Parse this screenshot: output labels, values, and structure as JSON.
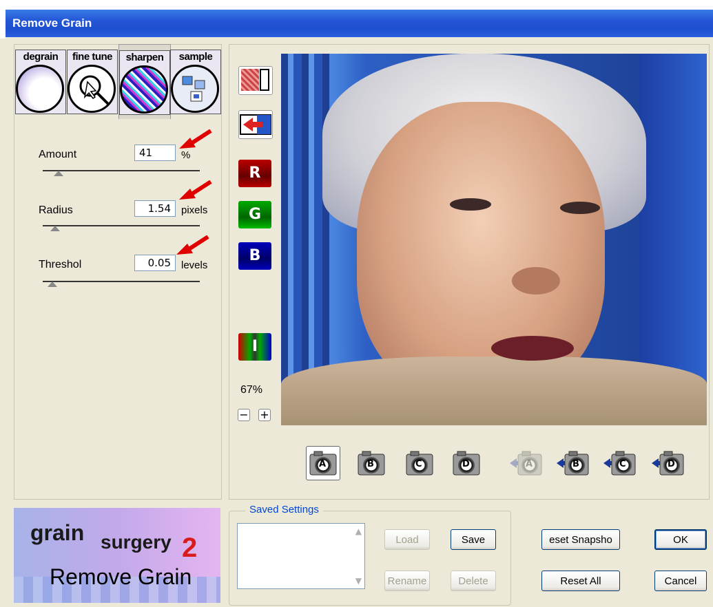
{
  "window": {
    "title": "Remove Grain"
  },
  "tabs": [
    {
      "label": "degrain"
    },
    {
      "label": "fine tune"
    },
    {
      "label": "sharpen"
    },
    {
      "label": "sample"
    }
  ],
  "params": {
    "amount": {
      "label": "Amount",
      "value": "41",
      "unit": "%",
      "slider": 0.07
    },
    "radius": {
      "label": "Radius",
      "value": "1.54",
      "unit": "pixels",
      "slider": 0.05
    },
    "threshold": {
      "label": "Threshol",
      "value": "0.05",
      "unit": "levels",
      "slider": 0.03
    }
  },
  "view": {
    "buttons": [
      "snapshot-split-icon",
      "compare-swap-icon",
      "red-channel-icon",
      "green-channel-icon",
      "blue-channel-icon",
      "intensity-channel-icon"
    ],
    "zoom": "67%",
    "zoom_out": "−",
    "zoom_in": "+"
  },
  "snapshots": [
    {
      "letter": "A",
      "active": true
    },
    {
      "letter": "B"
    },
    {
      "letter": "C"
    },
    {
      "letter": "D"
    },
    {
      "letter": "A",
      "store": true,
      "disabled": true
    },
    {
      "letter": "B",
      "store": true
    },
    {
      "letter": "C",
      "store": true
    },
    {
      "letter": "D",
      "store": true
    }
  ],
  "logo": {
    "brand1": "grain",
    "brand2": "surgery",
    "version": "2",
    "subtitle": "Remove Grain"
  },
  "saved_settings": {
    "title": "Saved Settings",
    "load": "Load",
    "save": "Save",
    "rename": "Rename",
    "delete": "Delete"
  },
  "actions": {
    "reset_snapshot": "eset Snapsho",
    "reset_all": "Reset All",
    "ok": "OK",
    "cancel": "Cancel"
  },
  "colors": {
    "titlebar": "#2456d6",
    "arrow": "#e00000"
  }
}
